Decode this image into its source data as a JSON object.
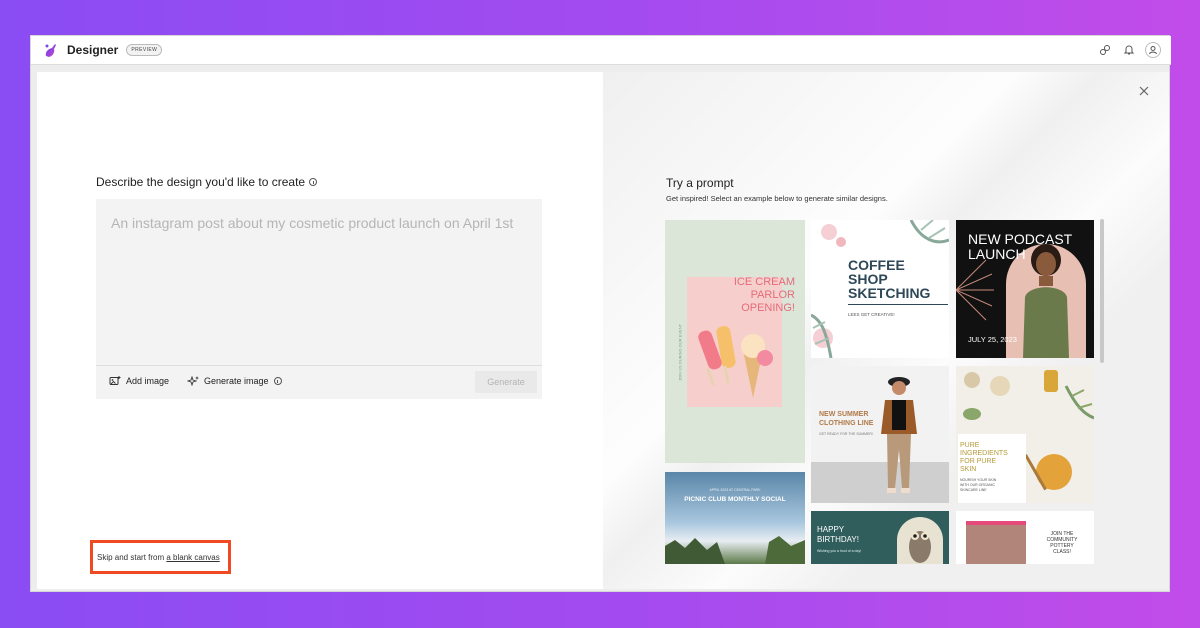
{
  "app": {
    "brand": "Designer",
    "badge": "PREVIEW"
  },
  "left": {
    "title": "Describe the design you'd like to create",
    "prompt_placeholder": "An instagram post about my cosmetic product launch on April 1st",
    "add_image": "Add image",
    "generate_image": "Generate image",
    "generate": "Generate",
    "skip_prefix": "Skip and start from ",
    "skip_link": "a blank canvas"
  },
  "right": {
    "title": "Try a prompt",
    "subtitle": "Get inspired! Select an example below to generate similar designs.",
    "cards": {
      "ice_cream": {
        "line1": "ICE CREAM",
        "line2": "PARLOR",
        "line3": "OPENING!",
        "side": "JOIN US DURING OUR EVENT"
      },
      "coffee": {
        "line1": "COFFEE",
        "line2": "SHOP",
        "line3": "SKETCHING",
        "sub": "LEES GET CREATIVE!"
      },
      "podcast": {
        "line1": "NEW PODCAST",
        "line2": "LAUNCH",
        "date": "JULY 25, 2023"
      },
      "summer": {
        "line1": "NEW SUMMER",
        "line2": "CLOTHING LINE",
        "sub": "GET READY FOR THE SUMMER!"
      },
      "pure": {
        "line1": "PURE",
        "line2": "INGREDIENTS",
        "line3": "FOR PURE",
        "line4": "SKIN",
        "sub1": "NOURISH YOUR SKIN",
        "sub2": "WITH OUR ORGANIC",
        "sub3": "SKINCARE LINE"
      },
      "picnic": {
        "top": "APRIL 2023 AT CENTRAL PARK",
        "title": "PICNIC CLUB MONTHLY SOCIAL"
      },
      "birthday": {
        "line1": "HAPPY",
        "line2": "BIRTHDAY!",
        "sub": "Wishing you a hoot of a day!"
      },
      "pottery": {
        "line1": "JOIN THE",
        "line2": "COMMUNITY",
        "line3": "POTTERY",
        "line4": "CLASS!"
      }
    }
  },
  "colors": {
    "highlight": "#ef4a22",
    "coffee_text": "#2f4858",
    "podcast_bg": "#111111",
    "summer_text": "#b07a4a",
    "birthday_bg": "#2f5e5c"
  }
}
